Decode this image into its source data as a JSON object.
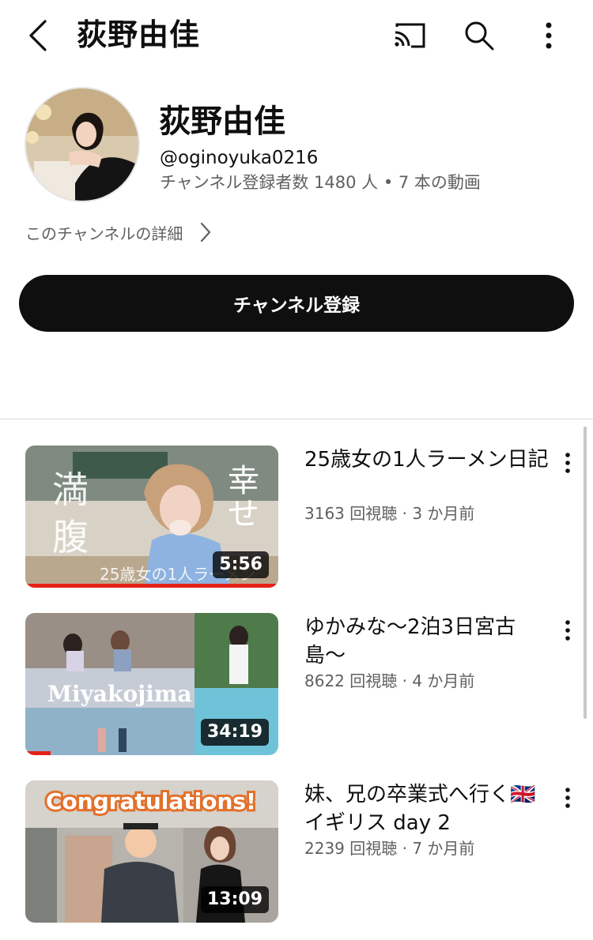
{
  "topbar": {
    "title": "荻野由佳",
    "icons": [
      "back-icon",
      "cast-icon",
      "search-icon",
      "more-vert-icon"
    ]
  },
  "channel": {
    "name": "荻野由佳",
    "handle": "@oginoyuka0216",
    "stats": "チャンネル登録者数 1480 人 • 7 本の動画",
    "details_link": "このチャンネルの詳細",
    "subscribe_label": "チャンネル登録"
  },
  "videos": [
    {
      "title": "25歳女の1人ラーメン日記",
      "meta": "3163 回視聴 · 3 か月前",
      "duration": "5:56",
      "watched_fraction": 1.0,
      "thumb_text": {
        "left": "満腹",
        "right": "幸せ",
        "caption": "25歳女の1人ラーメン"
      }
    },
    {
      "title": "ゆかみな〜2泊3日宮古島〜",
      "meta": "8622 回視聴 · 4 か月前",
      "duration": "34:19",
      "watched_fraction": 0.1,
      "thumb_text": {
        "label": "Miyakojima"
      }
    },
    {
      "title": "妹、兄の卒業式へ行く🇬🇧イギリス day 2",
      "meta": "2239 回視聴 · 7 か月前",
      "duration": "13:09",
      "watched_fraction": 0,
      "thumb_text": {
        "label": "Congratulations!"
      }
    }
  ],
  "colors": {
    "text": "#0f0f0f",
    "secondary": "#606060",
    "button_bg": "#0f0f0f",
    "progress": "#e62117"
  }
}
